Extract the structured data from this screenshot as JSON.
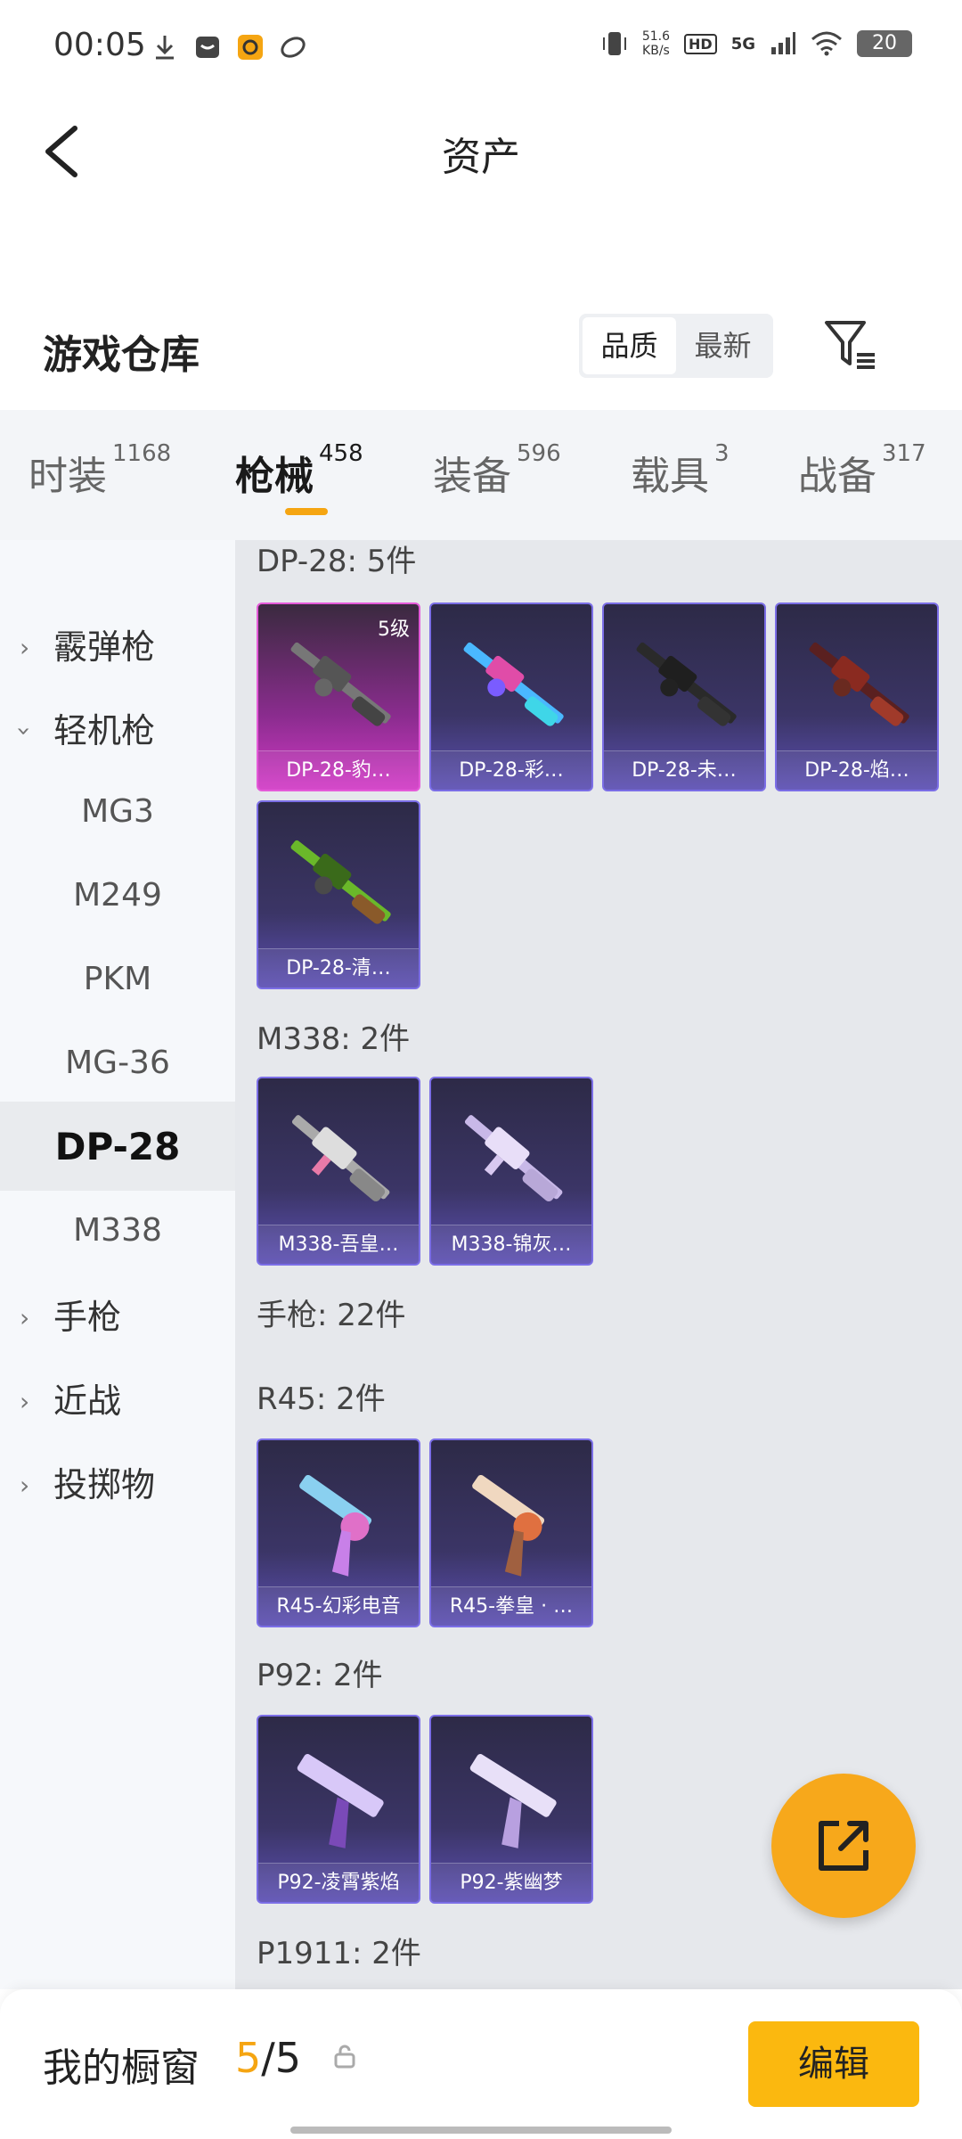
{
  "status_bar": {
    "time": "00:05",
    "speed_value": "51.6",
    "speed_unit": "KB/s",
    "hd": "HD",
    "network": "5G",
    "battery": "20"
  },
  "header": {
    "title": "资产",
    "back_icon": "chevron-left-icon"
  },
  "warehouse": {
    "title": "游戏仓库",
    "sort_options": [
      "品质",
      "最新"
    ],
    "active_sort": "品质",
    "filter_icon": "filter-icon"
  },
  "tabs": [
    {
      "label": "时装",
      "count": "1168"
    },
    {
      "label": "枪械",
      "count": "458"
    },
    {
      "label": "装备",
      "count": "596"
    },
    {
      "label": "载具",
      "count": "3"
    },
    {
      "label": "战备",
      "count": "317"
    }
  ],
  "active_tab": "枪械",
  "sidebar": [
    {
      "label": "霰弹枪",
      "type": "category",
      "expanded": false
    },
    {
      "label": "轻机枪",
      "type": "category",
      "expanded": true
    },
    {
      "label": "MG3",
      "type": "sub"
    },
    {
      "label": "M249",
      "type": "sub"
    },
    {
      "label": "PKM",
      "type": "sub"
    },
    {
      "label": "MG-36",
      "type": "sub"
    },
    {
      "label": "DP-28",
      "type": "sub",
      "active": true
    },
    {
      "label": "M338",
      "type": "sub"
    },
    {
      "label": "手枪",
      "type": "category",
      "expanded": false
    },
    {
      "label": "近战",
      "type": "category",
      "expanded": false
    },
    {
      "label": "投掷物",
      "type": "category",
      "expanded": false
    }
  ],
  "sections": [
    {
      "label": "DP-28: 5件",
      "items": [
        {
          "name": "DP-28-豹…",
          "level": "5级",
          "rarity": "pink"
        },
        {
          "name": "DP-28-彩…",
          "rarity": "purple"
        },
        {
          "name": "DP-28-未…",
          "rarity": "purple"
        },
        {
          "name": "DP-28-焰…",
          "rarity": "purple"
        },
        {
          "name": "DP-28-清…",
          "rarity": "purple"
        }
      ]
    },
    {
      "label": "M338: 2件",
      "items": [
        {
          "name": "M338-吾皇…",
          "rarity": "purple"
        },
        {
          "name": "M338-锦灰…",
          "rarity": "purple"
        }
      ]
    },
    {
      "label": "手枪: 22件",
      "items": []
    },
    {
      "label": "R45: 2件",
      "items": [
        {
          "name": "R45-幻彩电音",
          "rarity": "purple"
        },
        {
          "name": "R45-拳皇 · …",
          "rarity": "purple"
        }
      ]
    },
    {
      "label": "P92: 2件",
      "items": [
        {
          "name": "P92-凌霄紫焰",
          "rarity": "purple"
        },
        {
          "name": "P92-紫幽梦",
          "rarity": "purple"
        }
      ]
    },
    {
      "label": "P1911: 2件",
      "items": []
    }
  ],
  "fab_icon": "share-icon",
  "bottom": {
    "title": "我的橱窗",
    "count_current": "5",
    "count_separator": "/",
    "count_total": "5",
    "lock_icon": "lock-icon",
    "edit_label": "编辑"
  },
  "colors": {
    "accent": "#f5a512",
    "edit_button": "#fbb80f",
    "card_purple": "#5c4fb3",
    "card_pink": "#d23ac6"
  }
}
